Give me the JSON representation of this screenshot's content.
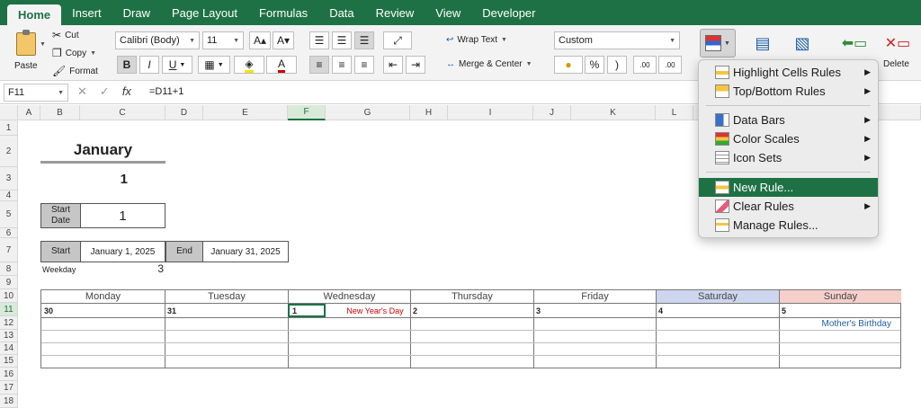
{
  "tabs": [
    "Home",
    "Insert",
    "Draw",
    "Page Layout",
    "Formulas",
    "Data",
    "Review",
    "View",
    "Developer"
  ],
  "ribbon": {
    "paste": "Paste",
    "cut": "Cut",
    "copy": "Copy",
    "format": "Format",
    "font_name": "Calibri (Body)",
    "font_size": "11",
    "bold": "B",
    "italic": "I",
    "underline": "U",
    "wrap_text": "Wrap Text",
    "merge_center": "Merge & Center",
    "number_format": "Custom",
    "percent": "%",
    "comma": ")",
    "inc_decimal": ".00",
    "dec_decimal": ".00",
    "delete": "Delete"
  },
  "formula_bar": {
    "name_box": "F11",
    "fx": "fx",
    "formula": "=D11+1"
  },
  "columns": [
    "A",
    "B",
    "C",
    "D",
    "E",
    "F",
    "G",
    "H",
    "I",
    "J",
    "K",
    "L"
  ],
  "rows": [
    "1",
    "2",
    "3",
    "4",
    "5",
    "6",
    "7",
    "8",
    "9",
    "10",
    "11",
    "12",
    "13",
    "14",
    "15",
    "16",
    "17",
    "18"
  ],
  "sheet": {
    "month": "January",
    "month_number": "1",
    "start_date_label": "Start Date",
    "start_date_value": "1",
    "start_label": "Start",
    "start_value": "January 1, 2025",
    "end_label": "End",
    "end_value": "January 31, 2025",
    "weekday_label": "Weekday",
    "weekday_value": "3"
  },
  "calendar": {
    "days": [
      "Monday",
      "Tuesday",
      "Wednesday",
      "Thursday",
      "Friday",
      "Saturday",
      "Sunday"
    ],
    "dates": [
      "30",
      "31",
      "1",
      "2",
      "3",
      "4",
      "5"
    ],
    "events": {
      "wednesday": "New Year's Day",
      "sunday": "Mother's Birthday"
    },
    "colors": {
      "saturday": "#cdd6ee",
      "sunday": "#f6cfca",
      "holiday": "#d00000",
      "birthday": "#1f5fa8"
    }
  },
  "cond_format_menu": {
    "items": [
      {
        "label": "Highlight Cells Rules",
        "submenu": true
      },
      {
        "label": "Top/Bottom Rules",
        "submenu": true
      },
      {
        "label": "Data Bars",
        "submenu": true
      },
      {
        "label": "Color Scales",
        "submenu": true
      },
      {
        "label": "Icon Sets",
        "submenu": true
      },
      {
        "label": "New Rule...",
        "submenu": false,
        "highlighted": true
      },
      {
        "label": "Clear Rules",
        "submenu": true
      },
      {
        "label": "Manage Rules...",
        "submenu": false
      }
    ]
  },
  "accent": "#1e7145"
}
